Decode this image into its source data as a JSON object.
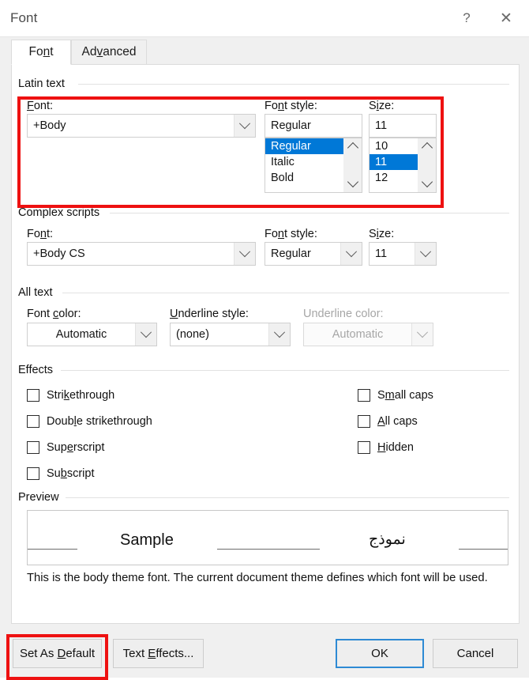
{
  "window": {
    "title": "Font",
    "help_icon": "question-mark-icon",
    "close_icon": "close-x-icon",
    "help_glyph": "?",
    "close_glyph": "✕"
  },
  "tabs": [
    {
      "label": "Font",
      "pre": "Fo",
      "key": "n",
      "post": "t",
      "active": true
    },
    {
      "label": "Advanced",
      "pre": "Ad",
      "key": "v",
      "post": "anced",
      "active": false
    }
  ],
  "latin_text": {
    "group_label": "Latin text",
    "font": {
      "label_pre": "",
      "label_key": "F",
      "label_post": "ont:",
      "label": "Font:",
      "value": "+Body"
    },
    "font_style": {
      "label_pre": "Fo",
      "label_key": "n",
      "label_post": "t style:",
      "label": "Font style:",
      "value": "Regular",
      "options": [
        "Regular",
        "Italic",
        "Bold"
      ],
      "selected": "Regular"
    },
    "size": {
      "label_pre": "S",
      "label_key": "i",
      "label_post": "ze:",
      "label": "Size:",
      "value": "11",
      "options": [
        "10",
        "11",
        "12"
      ],
      "selected": "11"
    }
  },
  "complex_scripts": {
    "group_label": "Complex scripts",
    "font": {
      "label_pre": "Fo",
      "label_key": "n",
      "label_post": "t:",
      "label": "Font:",
      "value": "+Body CS"
    },
    "font_style": {
      "label_pre": "Fo",
      "label_key": "n",
      "label_post": "t style:",
      "label": "Font style:",
      "value": "Regular"
    },
    "size": {
      "label_pre": "S",
      "label_key": "i",
      "label_post": "ze:",
      "label": "Size:",
      "value": "11"
    }
  },
  "all_text": {
    "group_label": "All text",
    "font_color": {
      "label_pre": "Font ",
      "label_key": "c",
      "label_post": "olor:",
      "label": "Font color:",
      "value": "Automatic",
      "disabled": false
    },
    "underline_style": {
      "label_pre": "",
      "label_key": "U",
      "label_post": "nderline style:",
      "label": "Underline style:",
      "value": "(none)",
      "disabled": false
    },
    "underline_color": {
      "label": "Underline color:",
      "value": "Automatic",
      "disabled": true
    }
  },
  "effects": {
    "group_label": "Effects",
    "left_column": [
      {
        "label": "Strikethrough",
        "pre": "Stri",
        "key": "k",
        "post": "ethrough",
        "checked": false
      },
      {
        "label": "Double strikethrough",
        "pre": "Doub",
        "key": "l",
        "post": "e strikethrough",
        "checked": false
      },
      {
        "label": "Superscript",
        "pre": "Sup",
        "key": "e",
        "post": "rscript",
        "checked": false
      },
      {
        "label": "Subscript",
        "pre": "Su",
        "key": "b",
        "post": "script",
        "checked": false
      }
    ],
    "right_column": [
      {
        "label": "Small caps",
        "pre": "S",
        "key": "m",
        "post": "all caps",
        "checked": false
      },
      {
        "label": "All caps",
        "pre": "",
        "key": "A",
        "post": "ll caps",
        "checked": false
      },
      {
        "label": "Hidden",
        "pre": "",
        "key": "H",
        "post": "idden",
        "checked": false
      }
    ]
  },
  "preview": {
    "group_label": "Preview",
    "sample_latin": "Sample",
    "sample_arabic": "نموذج",
    "note": "This is the body theme font. The current document theme defines which font will be used."
  },
  "buttons": {
    "set_as_default": {
      "label": "Set As Default",
      "pre": "Set As ",
      "key": "D",
      "post": "efault",
      "highlighted": true
    },
    "text_effects": {
      "label": "Text Effects...",
      "pre": "Text ",
      "key": "E",
      "post": "ffects..."
    },
    "ok": {
      "label": "OK",
      "is_default": true
    },
    "cancel": {
      "label": "Cancel"
    }
  },
  "annotations": {
    "accent_red": "#ee1111",
    "selection_blue": "#0078d7",
    "default_button_blue": "#2e8ad4"
  }
}
